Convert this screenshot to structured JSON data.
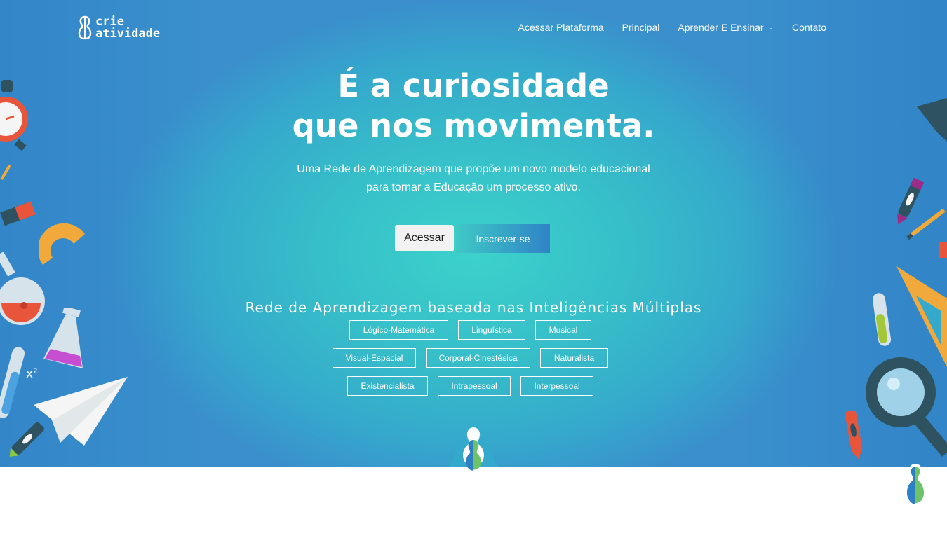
{
  "brand": {
    "line1": "crie",
    "line2": "atividade"
  },
  "nav": {
    "items": [
      {
        "label": "Acessar Plataforma"
      },
      {
        "label": "Principal"
      },
      {
        "label": "Aprender E Ensinar",
        "icon": "chevron-down-icon"
      },
      {
        "label": "Contato"
      }
    ]
  },
  "hero": {
    "title_line1": "É a curiosidade",
    "title_line2": "que nos movimenta.",
    "subtitle_line1": "Uma Rede de Aprendizagem que propõe um novo modelo educacional",
    "subtitle_line2": "para tornar a Educação um processo ativo.",
    "btn_acessar": "Acessar",
    "btn_inscrever": "Inscrever-se"
  },
  "intelligences": {
    "heading": "Rede de Aprendizagem baseada nas Inteligências Múltiplas",
    "tags": [
      "Lógico-Matemática",
      "Linguística",
      "Musical",
      "Visual-Espacial",
      "Corporal-Cinestésica",
      "Naturalista",
      "Existencialista",
      "Intrapessoal",
      "Interpessoal"
    ]
  },
  "decorations": {
    "math_label": "x",
    "math_exp": "2"
  },
  "colors": {
    "accent_gradient_start": "#3fc9c6",
    "accent_gradient_end": "#2f83c7",
    "hero_center": "#3cd2cb",
    "hero_edge": "#3a8fcc"
  }
}
